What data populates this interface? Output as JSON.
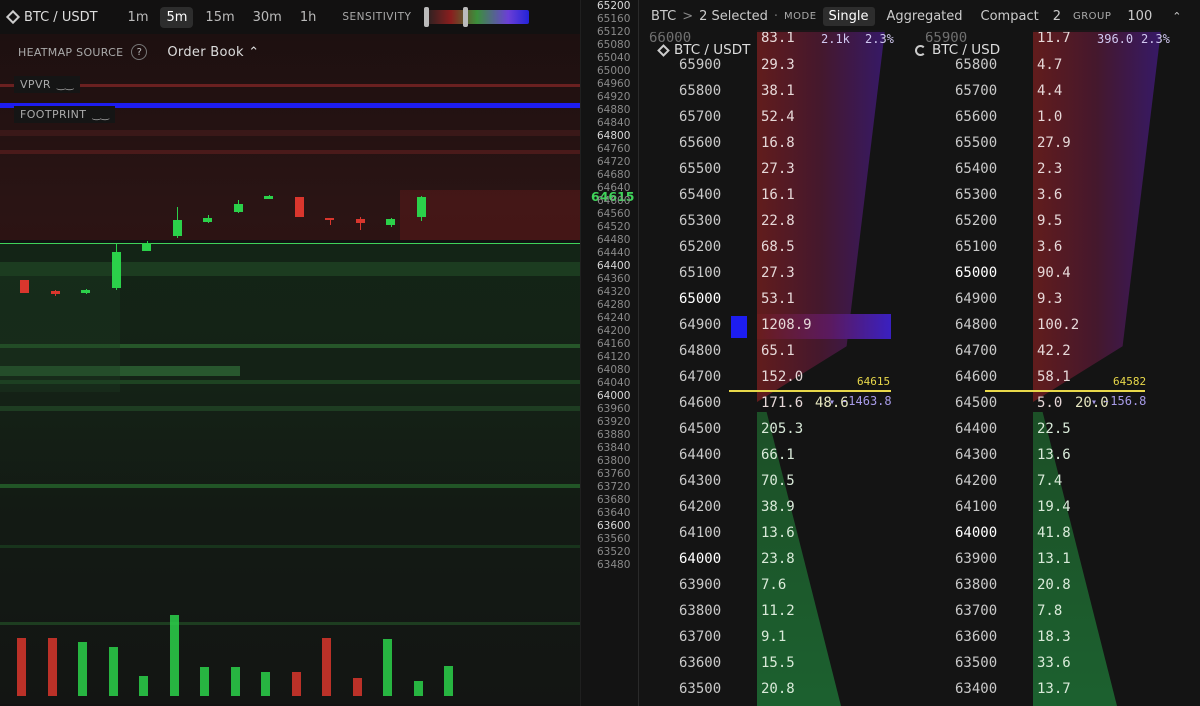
{
  "chart_toolbar": {
    "symbol": "BTC / USDT",
    "timeframes": [
      "1m",
      "5m",
      "15m",
      "30m",
      "1h"
    ],
    "active_timeframe": "5m",
    "sensitivity_label": "SENSITIVITY"
  },
  "heatmap_source": {
    "label": "HEATMAP SOURCE",
    "help": "?",
    "value": "Order Book ⌃"
  },
  "indicators": {
    "vpvr": "VPVR",
    "footprint": "FOOTPRINT"
  },
  "price_axis": {
    "ticks": [
      "65200",
      "65160",
      "65120",
      "65080",
      "65040",
      "65000",
      "64960",
      "64920",
      "64880",
      "64840",
      "64800",
      "64760",
      "64720",
      "64680",
      "64640",
      "64600",
      "64560",
      "64520",
      "64480",
      "64440",
      "64400",
      "64360",
      "64320",
      "64280",
      "64240",
      "64200",
      "64160",
      "64120",
      "64080",
      "64040",
      "64000",
      "63960",
      "63920",
      "63880",
      "63840",
      "63800",
      "63760",
      "63720",
      "63680",
      "63640",
      "63600",
      "63560",
      "63520",
      "63480"
    ],
    "major_ticks": [
      "65200",
      "64800",
      "64400",
      "64000",
      "63600"
    ],
    "current_price": "64615"
  },
  "candles": [
    {
      "o": 64360,
      "c": 64320,
      "h": 64360,
      "l": 64320
    },
    {
      "o": 64325,
      "c": 64318,
      "h": 64330,
      "l": 64310
    },
    {
      "o": 64320,
      "c": 64330,
      "h": 64332,
      "l": 64318
    },
    {
      "o": 64335,
      "c": 64445,
      "h": 64470,
      "l": 64330
    },
    {
      "o": 64450,
      "c": 64475,
      "h": 64480,
      "l": 64448
    },
    {
      "o": 64495,
      "c": 64545,
      "h": 64585,
      "l": 64490
    },
    {
      "o": 64540,
      "c": 64550,
      "h": 64560,
      "l": 64535
    },
    {
      "o": 64570,
      "c": 64595,
      "h": 64605,
      "l": 64565
    },
    {
      "o": 64610,
      "c": 64620,
      "h": 64622,
      "l": 64608
    },
    {
      "o": 64615,
      "c": 64555,
      "h": 64615,
      "l": 64555
    },
    {
      "o": 64550,
      "c": 64544,
      "h": 64552,
      "l": 64530
    },
    {
      "o": 64548,
      "c": 64535,
      "h": 64555,
      "l": 64515
    },
    {
      "o": 64530,
      "c": 64548,
      "h": 64552,
      "l": 64524
    },
    {
      "o": 64555,
      "c": 64615,
      "h": 64618,
      "l": 64542
    }
  ],
  "volumes": [
    0.65,
    0.65,
    0.6,
    0.55,
    0.22,
    0.9,
    0.32,
    0.32,
    0.27,
    0.27,
    0.65,
    0.2,
    0.63,
    0.17,
    0.33
  ],
  "colors": {
    "up": "#2bd14a",
    "down": "#d9362d",
    "accent_line": "#3fd35a",
    "blue_band": "#1d1df0",
    "mid_line": "#e8d84a"
  },
  "ladder_header": {
    "root": "BTC",
    "chevron": ">",
    "selected": "2 Selected",
    "mode_label": "MODE",
    "modes": [
      "Single",
      "Aggregated",
      "Compact"
    ],
    "active_mode": "Single",
    "compact_count": "2",
    "group_label": "GROUP",
    "group_value": "100",
    "group_chevron": "⌃"
  },
  "ladders": [
    {
      "title": "BTC / USDT",
      "top_price": "66000",
      "top_size": "83.1",
      "top_cum": "2.1k",
      "top_pct": "2.3%",
      "rows": [
        {
          "p": "65900",
          "s": "29.3",
          "side": "ask"
        },
        {
          "p": "65800",
          "s": "38.1",
          "side": "ask"
        },
        {
          "p": "65700",
          "s": "52.4",
          "side": "ask"
        },
        {
          "p": "65600",
          "s": "16.8",
          "side": "ask"
        },
        {
          "p": "65500",
          "s": "27.3",
          "side": "ask"
        },
        {
          "p": "65400",
          "s": "16.1",
          "side": "ask"
        },
        {
          "p": "65300",
          "s": "22.8",
          "side": "ask"
        },
        {
          "p": "65200",
          "s": "68.5",
          "side": "ask"
        },
        {
          "p": "65100",
          "s": "27.3",
          "side": "ask"
        },
        {
          "p": "65000",
          "s": "53.1",
          "side": "ask",
          "bright": true
        },
        {
          "p": "64900",
          "s": "1208.9",
          "side": "ask",
          "big": true
        },
        {
          "p": "64800",
          "s": "65.1",
          "side": "ask"
        },
        {
          "p": "64700",
          "s": "152.0",
          "side": "ask"
        },
        {
          "p": "64600",
          "s": "171.6",
          "side": "mid",
          "trade": "48.6"
        },
        {
          "p": "64500",
          "s": "205.3",
          "side": "bid"
        },
        {
          "p": "64400",
          "s": "66.1",
          "side": "bid"
        },
        {
          "p": "64300",
          "s": "70.5",
          "side": "bid"
        },
        {
          "p": "64200",
          "s": "38.9",
          "side": "bid"
        },
        {
          "p": "64100",
          "s": "13.6",
          "side": "bid"
        },
        {
          "p": "64000",
          "s": "23.8",
          "side": "bid",
          "bright": true
        },
        {
          "p": "63900",
          "s": "7.6",
          "side": "bid"
        },
        {
          "p": "63800",
          "s": "11.2",
          "side": "bid"
        },
        {
          "p": "63700",
          "s": "9.1",
          "side": "bid"
        },
        {
          "p": "63600",
          "s": "15.5",
          "side": "bid"
        },
        {
          "p": "63500",
          "s": "20.8",
          "side": "bid"
        }
      ],
      "mid_price": "64615",
      "delta": "-1463.8"
    },
    {
      "title": "BTC / USD",
      "top_price": "65900",
      "top_size": "11.7",
      "top_cum": "396.0",
      "top_pct": "2.3%",
      "rows": [
        {
          "p": "65800",
          "s": "4.7",
          "side": "ask"
        },
        {
          "p": "65700",
          "s": "4.4",
          "side": "ask"
        },
        {
          "p": "65600",
          "s": "1.0",
          "side": "ask"
        },
        {
          "p": "65500",
          "s": "27.9",
          "side": "ask"
        },
        {
          "p": "65400",
          "s": "2.3",
          "side": "ask"
        },
        {
          "p": "65300",
          "s": "3.6",
          "side": "ask"
        },
        {
          "p": "65200",
          "s": "9.5",
          "side": "ask"
        },
        {
          "p": "65100",
          "s": "3.6",
          "side": "ask"
        },
        {
          "p": "65000",
          "s": "90.4",
          "side": "ask",
          "bright": true
        },
        {
          "p": "64900",
          "s": "9.3",
          "side": "ask"
        },
        {
          "p": "64800",
          "s": "100.2",
          "side": "ask"
        },
        {
          "p": "64700",
          "s": "42.2",
          "side": "ask"
        },
        {
          "p": "64600",
          "s": "58.1",
          "side": "ask"
        },
        {
          "p": "64500",
          "s": "5.0",
          "side": "mid",
          "trade": "20.0"
        },
        {
          "p": "64400",
          "s": "22.5",
          "side": "bid"
        },
        {
          "p": "64300",
          "s": "13.6",
          "side": "bid"
        },
        {
          "p": "64200",
          "s": "7.4",
          "side": "bid"
        },
        {
          "p": "64100",
          "s": "19.4",
          "side": "bid"
        },
        {
          "p": "64000",
          "s": "41.8",
          "side": "bid",
          "bright": true
        },
        {
          "p": "63900",
          "s": "13.1",
          "side": "bid"
        },
        {
          "p": "63800",
          "s": "20.8",
          "side": "bid"
        },
        {
          "p": "63700",
          "s": "7.8",
          "side": "bid"
        },
        {
          "p": "63600",
          "s": "18.3",
          "side": "bid"
        },
        {
          "p": "63500",
          "s": "33.6",
          "side": "bid"
        },
        {
          "p": "63400",
          "s": "13.7",
          "side": "bid"
        }
      ],
      "mid_price": "64582",
      "delta": "-156.8"
    }
  ]
}
